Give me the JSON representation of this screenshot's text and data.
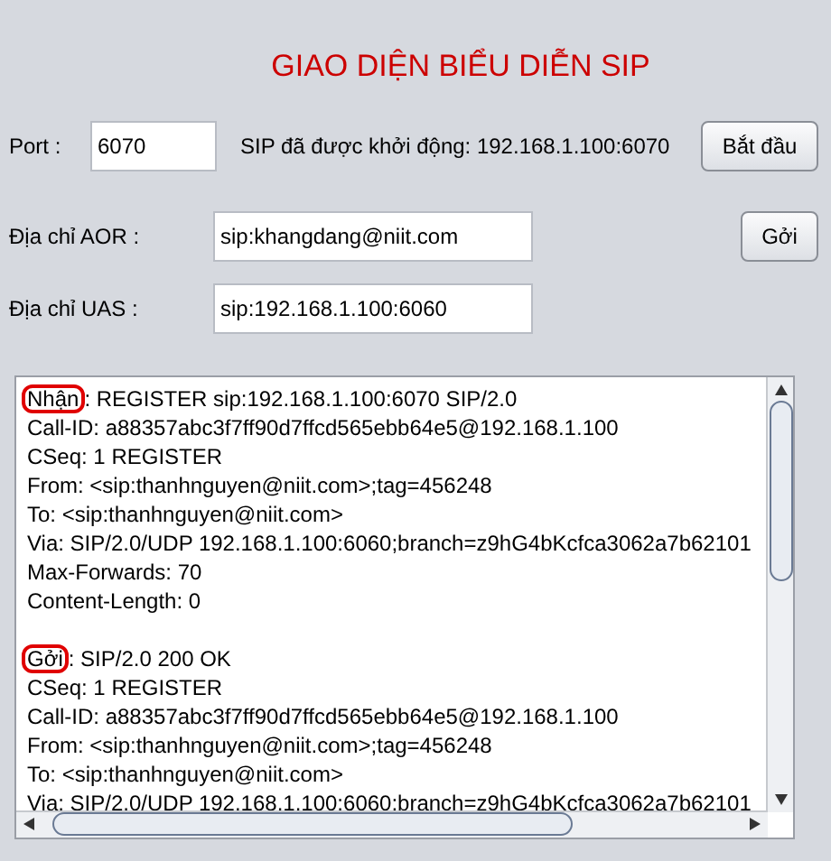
{
  "title": "GIAO DIỆN BIỂU DIỄN SIP",
  "port": {
    "label": "Port :",
    "value": "6070"
  },
  "status": "SIP đã được khởi động: 192.168.1.100:6070",
  "start_button": "Bắt đầu",
  "aor": {
    "label": "Địa chỉ AOR :",
    "value": "sip:khangdang@niit.com"
  },
  "uas": {
    "label": "Địa chỉ UAS :",
    "value": "sip:192.168.1.100:6060"
  },
  "send_button": "Gởi",
  "log": [
    {
      "label": "Nhận",
      "highlighted": true,
      "first_line": ": REGISTER sip:192.168.1.100:6070 SIP/2.0",
      "lines": [
        "Call-ID: a88357abc3f7ff90d7ffcd565ebb64e5@192.168.1.100",
        "CSeq: 1 REGISTER",
        "From: <sip:thanhnguyen@niit.com>;tag=456248",
        "To: <sip:thanhnguyen@niit.com>",
        "Via: SIP/2.0/UDP 192.168.1.100:6060;branch=z9hG4bKcfca3062a7b62101",
        "Max-Forwards: 70",
        "Content-Length: 0"
      ]
    },
    {
      "label": "Gởi",
      "highlighted": true,
      "first_line": ": SIP/2.0 200 OK",
      "lines": [
        "CSeq: 1 REGISTER",
        "Call-ID: a88357abc3f7ff90d7ffcd565ebb64e5@192.168.1.100",
        "From: <sip:thanhnguyen@niit.com>;tag=456248",
        "To: <sip:thanhnguyen@niit.com>",
        "Via: SIP/2.0/UDP 192.168.1.100:6060;branch=z9hG4bKcfca3062a7b62101"
      ]
    }
  ]
}
